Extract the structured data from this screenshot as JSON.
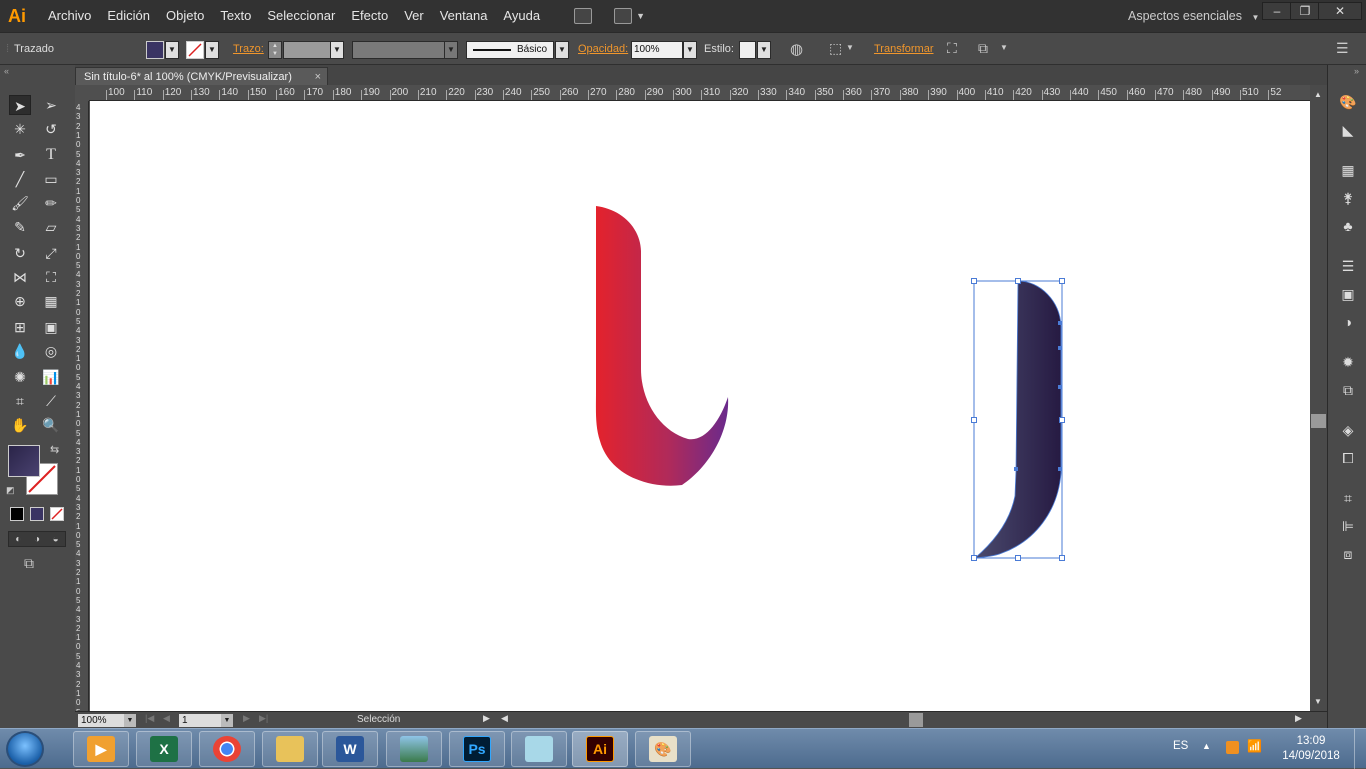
{
  "app": {
    "logo": "Ai",
    "workspace_label": "Aspectos esenciales"
  },
  "menu": [
    "Archivo",
    "Edición",
    "Objeto",
    "Texto",
    "Seleccionar",
    "Efecto",
    "Ver",
    "Ventana",
    "Ayuda"
  ],
  "control_bar": {
    "selection_label": "Trazado",
    "stroke_label": "Trazo:",
    "brush_label": "Básico",
    "opacity_label": "Opacidad:",
    "opacity_value": "100%",
    "style_label": "Estilo:",
    "transform_label": "Transformar"
  },
  "document": {
    "tab_title": "Sin título-6* al 100% (CMYK/Previsualizar)",
    "close": "×"
  },
  "ruler": {
    "h_ticks": [
      "100",
      "110",
      "120",
      "130",
      "140",
      "150",
      "160",
      "170",
      "180",
      "190",
      "200",
      "210",
      "220",
      "230",
      "240",
      "250",
      "260",
      "270",
      "280",
      "290",
      "300",
      "310",
      "320",
      "330",
      "340",
      "350",
      "360",
      "370",
      "380",
      "390",
      "400",
      "410",
      "420",
      "430",
      "440",
      "450",
      "460",
      "470",
      "480",
      "490",
      "510",
      "52"
    ]
  },
  "status": {
    "zoom": "100%",
    "artboard": "1",
    "tool_name": "Selección"
  },
  "taskbar": {
    "lang": "ES",
    "time": "13:09",
    "date": "14/09/2018",
    "apps": [
      "media-player",
      "excel",
      "chrome",
      "file-explorer",
      "word",
      "photo-viewer",
      "photoshop",
      "notes",
      "illustrator",
      "paint"
    ]
  },
  "colors": {
    "accent_orange": "#f0962c",
    "selection_blue": "#4a7bd6",
    "shape_red": "#e4222c",
    "shape_purple": "#6a2a8c",
    "shape_navy": "#2a1f4a"
  }
}
